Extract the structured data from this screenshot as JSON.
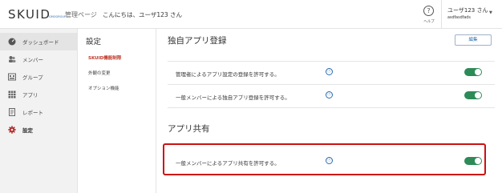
{
  "header": {
    "logo_text": "SKUID",
    "logo_sub": "GMOGROUP",
    "admin_label": "管理ページ",
    "greeting": "こんにちは、ユーザ123 さん",
    "help_label": "ヘルプ",
    "user_name": "ユーザ123 さん",
    "user_id": "asdfasdfads"
  },
  "sidebar": {
    "items": [
      {
        "label": "ダッシュボード",
        "icon": "dashboard-icon"
      },
      {
        "label": "メンバー",
        "icon": "members-icon"
      },
      {
        "label": "グループ",
        "icon": "group-icon"
      },
      {
        "label": "アプリ",
        "icon": "apps-grid-icon"
      },
      {
        "label": "レポート",
        "icon": "report-icon"
      },
      {
        "label": "設定",
        "icon": "gear-icon"
      }
    ]
  },
  "submenu": {
    "title": "設定",
    "items": [
      {
        "label": "SKUID機能制限",
        "active": true
      },
      {
        "label": "外観の変更"
      },
      {
        "label": "オプション機能"
      }
    ]
  },
  "main": {
    "section1_title": "独自アプリ登録",
    "edit_button": "編集",
    "section1_rows": [
      {
        "text": "管理者によるアプリ設定の登録を許可する。",
        "enabled": true
      },
      {
        "text": "一般メンバーによる独自アプリ登録を許可する。",
        "enabled": true
      }
    ],
    "section2_title": "アプリ共有",
    "section2_rows": [
      {
        "text": "一般メンバーによるアプリ共有を許可する。",
        "enabled": true
      }
    ],
    "info_glyph": "ⓘ"
  },
  "colors": {
    "toggle_on": "#2e8b57",
    "active_submenu": "#c0392b",
    "highlight_border": "#cc1111",
    "accent_blue": "#2b6cb0"
  }
}
